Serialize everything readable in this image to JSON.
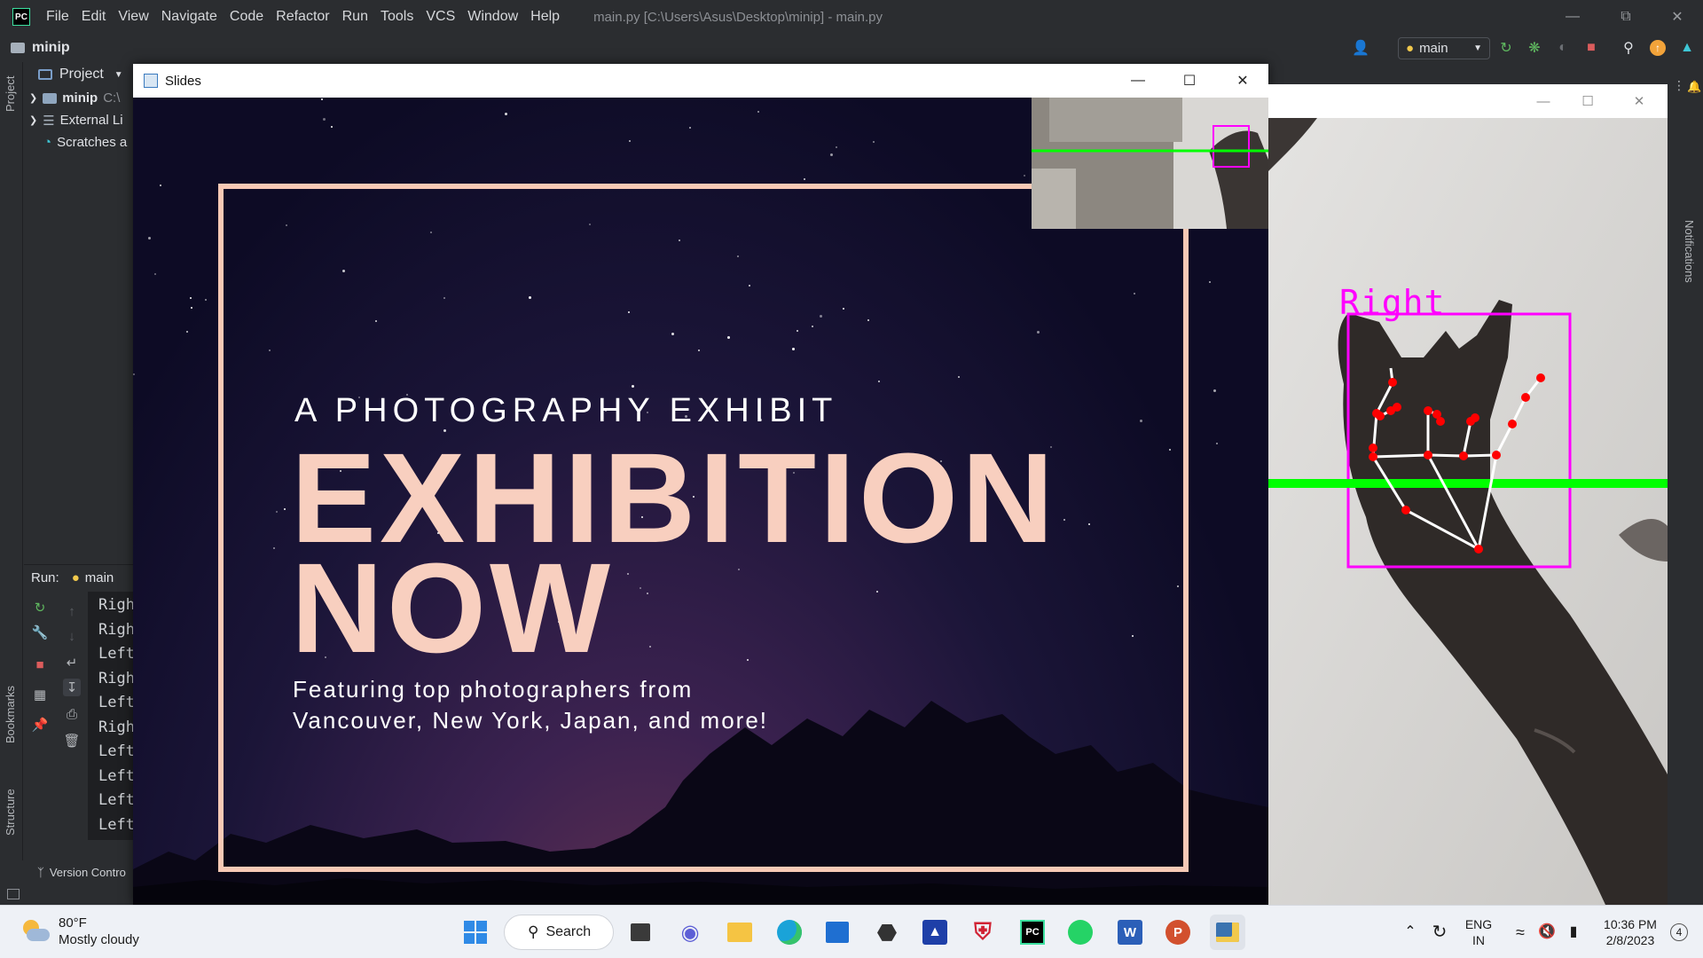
{
  "ide": {
    "menu": [
      "File",
      "Edit",
      "View",
      "Navigate",
      "Code",
      "Refactor",
      "Run",
      "Tools",
      "VCS",
      "Window",
      "Help"
    ],
    "window_title": "main.py [C:\\Users\\Asus\\Desktop\\minip] - main.py",
    "logo": "PC",
    "project_name": "minip",
    "run_config": "main",
    "left_stripe": {
      "project": "Project",
      "bookmarks": "Bookmarks",
      "structure": "Structure"
    },
    "right_stripe": {
      "notifications": "Notifications"
    },
    "project_panel": {
      "header": "Project",
      "tree": [
        {
          "label": "minip",
          "path": "C:\\"
        },
        {
          "label": "External Li"
        },
        {
          "label": "Scratches a"
        }
      ]
    },
    "run_panel": {
      "label": "Run:",
      "tab": "main",
      "console_lines": [
        "Righ",
        "Righ",
        "Left",
        "Righ",
        "Left",
        "Righ",
        "Left",
        "Left",
        "Left",
        "Left"
      ]
    },
    "status": {
      "version_control": "Version Contro"
    }
  },
  "slides_window": {
    "title": "Slides",
    "slide": {
      "kicker": "A PHOTOGRAPHY EXHIBIT",
      "headline_line1": "EXHIBITION",
      "headline_line2": "NOW",
      "subtitle_line1": "Featuring top photographers from",
      "subtitle_line2": "Vancouver, New York, Japan, and more!"
    }
  },
  "camera_window": {
    "hand_label": "Right",
    "colors": {
      "bbox": "#ff00ff",
      "landmark": "#ff0000",
      "threshold_line": "#00ff00"
    }
  },
  "taskbar": {
    "weather": {
      "temp": "80°F",
      "condition": "Mostly cloudy"
    },
    "search_label": "Search",
    "language": {
      "line1": "ENG",
      "line2": "IN"
    },
    "clock": {
      "time": "10:36 PM",
      "date": "2/8/2023"
    },
    "notification_count": "4"
  }
}
